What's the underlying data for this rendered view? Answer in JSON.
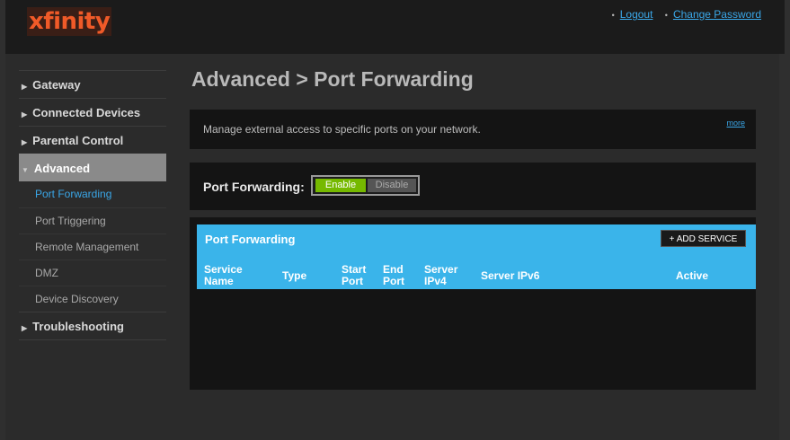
{
  "header": {
    "logo": "xfinity",
    "links": [
      "Logout",
      "Change Password"
    ]
  },
  "sidebar": {
    "items": [
      {
        "label": "Gateway"
      },
      {
        "label": "Connected Devices"
      },
      {
        "label": "Parental Control"
      },
      {
        "label": "Advanced"
      },
      {
        "label": "Troubleshooting"
      }
    ],
    "sub_items": [
      "Port Forwarding",
      "Port Triggering",
      "Remote Management",
      "DMZ",
      "Device Discovery"
    ]
  },
  "main": {
    "title": "Advanced > Port Forwarding",
    "description": "Manage external access to specific ports on your network.",
    "more_link": "more",
    "toggle_label": "Port Forwarding:",
    "enable_label": "Enable",
    "disable_label": "Disable",
    "table_title": "Port Forwarding",
    "add_service_label": "+ ADD SERVICE",
    "columns": [
      {
        "line1": "Service",
        "line2": "Name"
      },
      {
        "line1": "Type",
        "line2": ""
      },
      {
        "line1": "Start",
        "line2": "Port"
      },
      {
        "line1": "End",
        "line2": "Port"
      },
      {
        "line1": "Server",
        "line2": "IPv4"
      },
      {
        "line1": "Server IPv6",
        "line2": ""
      },
      {
        "line1": "Active",
        "line2": ""
      }
    ]
  },
  "colors": {
    "accent": "#3ab4ea",
    "enable": "#76b900",
    "logo": "#f05a28",
    "active_nav": "#8a8a8a"
  }
}
